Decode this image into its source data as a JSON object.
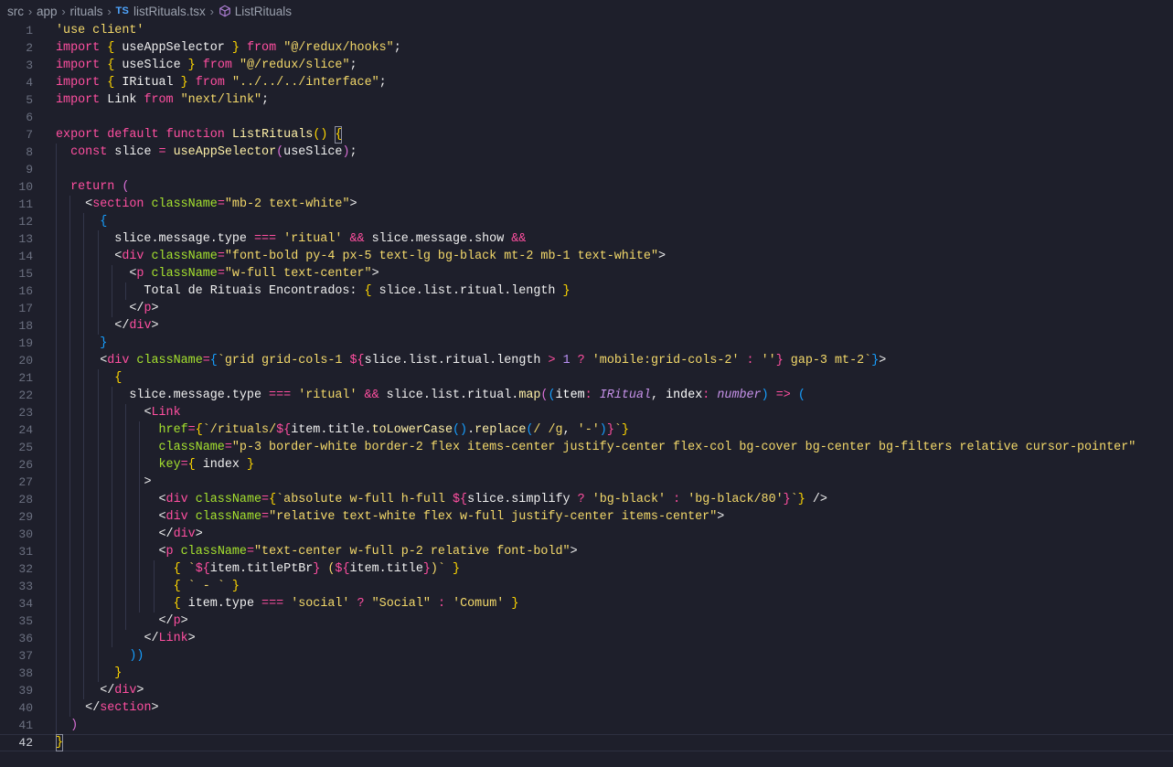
{
  "breadcrumb": {
    "items": [
      "src",
      "app",
      "rituals",
      "listRituals.tsx",
      "ListRituals"
    ],
    "file_badge": "TS"
  },
  "editor": {
    "current_line": 42,
    "lines": [
      [
        [
          "str",
          "'use client'"
        ]
      ],
      [
        [
          "kw",
          "import"
        ],
        [
          "t",
          " "
        ],
        [
          "br1",
          "{"
        ],
        [
          "t",
          " useAppSelector "
        ],
        [
          "br1",
          "}"
        ],
        [
          "t",
          " "
        ],
        [
          "kw",
          "from"
        ],
        [
          "t",
          " "
        ],
        [
          "str",
          "\"@/redux/hooks\""
        ],
        [
          "t",
          ";"
        ]
      ],
      [
        [
          "kw",
          "import"
        ],
        [
          "t",
          " "
        ],
        [
          "br1",
          "{"
        ],
        [
          "t",
          " useSlice "
        ],
        [
          "br1",
          "}"
        ],
        [
          "t",
          " "
        ],
        [
          "kw",
          "from"
        ],
        [
          "t",
          " "
        ],
        [
          "str",
          "\"@/redux/slice\""
        ],
        [
          "t",
          ";"
        ]
      ],
      [
        [
          "kw",
          "import"
        ],
        [
          "t",
          " "
        ],
        [
          "br1",
          "{"
        ],
        [
          "t",
          " IRitual "
        ],
        [
          "br1",
          "}"
        ],
        [
          "t",
          " "
        ],
        [
          "kw",
          "from"
        ],
        [
          "t",
          " "
        ],
        [
          "str",
          "\"../../../interface\""
        ],
        [
          "t",
          ";"
        ]
      ],
      [
        [
          "kw",
          "import"
        ],
        [
          "t",
          " Link "
        ],
        [
          "kw",
          "from"
        ],
        [
          "t",
          " "
        ],
        [
          "str",
          "\"next/link\""
        ],
        [
          "t",
          ";"
        ]
      ],
      [],
      [
        [
          "kw",
          "export"
        ],
        [
          "t",
          " "
        ],
        [
          "kw",
          "default"
        ],
        [
          "t",
          " "
        ],
        [
          "kw",
          "function"
        ],
        [
          "t",
          " "
        ],
        [
          "fn",
          "ListRituals"
        ],
        [
          "br1",
          "()"
        ],
        [
          "t",
          " "
        ],
        [
          "br1",
          "{"
        ]
      ],
      [
        [
          "t",
          "  "
        ],
        [
          "kw",
          "const"
        ],
        [
          "t",
          " slice "
        ],
        [
          "op",
          "="
        ],
        [
          "t",
          " "
        ],
        [
          "fn",
          "useAppSelector"
        ],
        [
          "br2",
          "("
        ],
        [
          "t",
          "useSlice"
        ],
        [
          "br2",
          ")"
        ],
        [
          "t",
          ";"
        ]
      ],
      [],
      [
        [
          "t",
          "  "
        ],
        [
          "kw",
          "return"
        ],
        [
          "t",
          " "
        ],
        [
          "br2",
          "("
        ]
      ],
      [
        [
          "t",
          "    "
        ],
        [
          "pun",
          "<"
        ],
        [
          "tag",
          "section"
        ],
        [
          "t",
          " "
        ],
        [
          "attr",
          "className"
        ],
        [
          "op",
          "="
        ],
        [
          "str",
          "\"mb-2 text-white\""
        ],
        [
          "pun",
          ">"
        ]
      ],
      [
        [
          "t",
          "      "
        ],
        [
          "br3",
          "{"
        ]
      ],
      [
        [
          "t",
          "        slice.message.type "
        ],
        [
          "op",
          "==="
        ],
        [
          "t",
          " "
        ],
        [
          "str",
          "'ritual'"
        ],
        [
          "t",
          " "
        ],
        [
          "op",
          "&&"
        ],
        [
          "t",
          " slice.message.show "
        ],
        [
          "op",
          "&&"
        ]
      ],
      [
        [
          "t",
          "        "
        ],
        [
          "pun",
          "<"
        ],
        [
          "tag",
          "div"
        ],
        [
          "t",
          " "
        ],
        [
          "attr",
          "className"
        ],
        [
          "op",
          "="
        ],
        [
          "str",
          "\"font-bold py-4 px-5 text-lg bg-black mt-2 mb-1 text-white\""
        ],
        [
          "pun",
          ">"
        ]
      ],
      [
        [
          "t",
          "          "
        ],
        [
          "pun",
          "<"
        ],
        [
          "tag",
          "p"
        ],
        [
          "t",
          " "
        ],
        [
          "attr",
          "className"
        ],
        [
          "op",
          "="
        ],
        [
          "str",
          "\"w-full text-center\""
        ],
        [
          "pun",
          ">"
        ]
      ],
      [
        [
          "t",
          "            Total de Rituais Encontrados: "
        ],
        [
          "br1",
          "{"
        ],
        [
          "t",
          " slice.list.ritual.length "
        ],
        [
          "br1",
          "}"
        ]
      ],
      [
        [
          "t",
          "          "
        ],
        [
          "pun",
          "</"
        ],
        [
          "tag",
          "p"
        ],
        [
          "pun",
          ">"
        ]
      ],
      [
        [
          "t",
          "        "
        ],
        [
          "pun",
          "</"
        ],
        [
          "tag",
          "div"
        ],
        [
          "pun",
          ">"
        ]
      ],
      [
        [
          "t",
          "      "
        ],
        [
          "br3",
          "}"
        ]
      ],
      [
        [
          "t",
          "      "
        ],
        [
          "pun",
          "<"
        ],
        [
          "tag",
          "div"
        ],
        [
          "t",
          " "
        ],
        [
          "attr",
          "className"
        ],
        [
          "op",
          "="
        ],
        [
          "br3",
          "{"
        ],
        [
          "tpl",
          "`grid grid-cols-1 "
        ],
        [
          "kw",
          "${"
        ],
        [
          "t",
          "slice.list.ritual.length "
        ],
        [
          "op",
          ">"
        ],
        [
          "t",
          " "
        ],
        [
          "num",
          "1"
        ],
        [
          "t",
          " "
        ],
        [
          "op",
          "?"
        ],
        [
          "t",
          " "
        ],
        [
          "str",
          "'mobile:grid-cols-2'"
        ],
        [
          "t",
          " "
        ],
        [
          "op",
          ":"
        ],
        [
          "t",
          " "
        ],
        [
          "str",
          "''"
        ],
        [
          "kw",
          "}"
        ],
        [
          "tpl",
          " gap-3 mt-2`"
        ],
        [
          "br3",
          "}"
        ],
        [
          "pun",
          ">"
        ]
      ],
      [
        [
          "t",
          "        "
        ],
        [
          "br1",
          "{"
        ]
      ],
      [
        [
          "t",
          "          slice.message.type "
        ],
        [
          "op",
          "==="
        ],
        [
          "t",
          " "
        ],
        [
          "str",
          "'ritual'"
        ],
        [
          "t",
          " "
        ],
        [
          "op",
          "&&"
        ],
        [
          "t",
          " slice.list.ritual."
        ],
        [
          "fn",
          "map"
        ],
        [
          "br2",
          "("
        ],
        [
          "br3",
          "("
        ],
        [
          "param",
          "item"
        ],
        [
          "op",
          ":"
        ],
        [
          "t",
          " "
        ],
        [
          "type",
          "IRitual"
        ],
        [
          "t",
          ", "
        ],
        [
          "param",
          "index"
        ],
        [
          "op",
          ":"
        ],
        [
          "t",
          " "
        ],
        [
          "type",
          "number"
        ],
        [
          "br3",
          ")"
        ],
        [
          "t",
          " "
        ],
        [
          "op",
          "=>"
        ],
        [
          "t",
          " "
        ],
        [
          "br3",
          "("
        ]
      ],
      [
        [
          "t",
          "            "
        ],
        [
          "pun",
          "<"
        ],
        [
          "tag",
          "Link"
        ]
      ],
      [
        [
          "t",
          "              "
        ],
        [
          "attr",
          "href"
        ],
        [
          "op",
          "="
        ],
        [
          "br1",
          "{"
        ],
        [
          "tpl",
          "`/rituals/"
        ],
        [
          "kw",
          "${"
        ],
        [
          "t",
          "item.title."
        ],
        [
          "fn",
          "toLowerCase"
        ],
        [
          "br3",
          "()"
        ],
        [
          "t",
          "."
        ],
        [
          "fn",
          "replace"
        ],
        [
          "br3",
          "("
        ],
        [
          "str",
          "/ /g"
        ],
        [
          "t",
          ", "
        ],
        [
          "str",
          "'-'"
        ],
        [
          "br3",
          ")"
        ],
        [
          "kw",
          "}"
        ],
        [
          "tpl",
          "`"
        ],
        [
          "br1",
          "}"
        ]
      ],
      [
        [
          "t",
          "              "
        ],
        [
          "attr",
          "className"
        ],
        [
          "op",
          "="
        ],
        [
          "str",
          "\"p-3 border-white border-2 flex items-center justify-center flex-col bg-cover bg-center bg-filters relative cursor-pointer\""
        ]
      ],
      [
        [
          "t",
          "              "
        ],
        [
          "attr",
          "key"
        ],
        [
          "op",
          "="
        ],
        [
          "br1",
          "{"
        ],
        [
          "t",
          " index "
        ],
        [
          "br1",
          "}"
        ]
      ],
      [
        [
          "t",
          "            "
        ],
        [
          "pun",
          ">"
        ]
      ],
      [
        [
          "t",
          "              "
        ],
        [
          "pun",
          "<"
        ],
        [
          "tag",
          "div"
        ],
        [
          "t",
          " "
        ],
        [
          "attr",
          "className"
        ],
        [
          "op",
          "="
        ],
        [
          "br1",
          "{"
        ],
        [
          "tpl",
          "`absolute w-full h-full "
        ],
        [
          "kw",
          "${"
        ],
        [
          "t",
          "slice.simplify "
        ],
        [
          "op",
          "?"
        ],
        [
          "t",
          " "
        ],
        [
          "str",
          "'bg-black'"
        ],
        [
          "t",
          " "
        ],
        [
          "op",
          ":"
        ],
        [
          "t",
          " "
        ],
        [
          "str",
          "'bg-black/80'"
        ],
        [
          "kw",
          "}"
        ],
        [
          "tpl",
          "`"
        ],
        [
          "br1",
          "}"
        ],
        [
          "t",
          " "
        ],
        [
          "pun",
          "/>"
        ]
      ],
      [
        [
          "t",
          "              "
        ],
        [
          "pun",
          "<"
        ],
        [
          "tag",
          "div"
        ],
        [
          "t",
          " "
        ],
        [
          "attr",
          "className"
        ],
        [
          "op",
          "="
        ],
        [
          "str",
          "\"relative text-white flex w-full justify-center items-center\""
        ],
        [
          "pun",
          ">"
        ]
      ],
      [
        [
          "t",
          "              "
        ],
        [
          "pun",
          "</"
        ],
        [
          "tag",
          "div"
        ],
        [
          "pun",
          ">"
        ]
      ],
      [
        [
          "t",
          "              "
        ],
        [
          "pun",
          "<"
        ],
        [
          "tag",
          "p"
        ],
        [
          "t",
          " "
        ],
        [
          "attr",
          "className"
        ],
        [
          "op",
          "="
        ],
        [
          "str",
          "\"text-center w-full p-2 relative font-bold\""
        ],
        [
          "pun",
          ">"
        ]
      ],
      [
        [
          "t",
          "                "
        ],
        [
          "br1",
          "{"
        ],
        [
          "t",
          " "
        ],
        [
          "tpl",
          "`"
        ],
        [
          "kw",
          "${"
        ],
        [
          "t",
          "item.titlePtBr"
        ],
        [
          "kw",
          "}"
        ],
        [
          "tpl",
          " ("
        ],
        [
          "kw",
          "${"
        ],
        [
          "t",
          "item.title"
        ],
        [
          "kw",
          "}"
        ],
        [
          "tpl",
          ")`"
        ],
        [
          "t",
          " "
        ],
        [
          "br1",
          "}"
        ]
      ],
      [
        [
          "t",
          "                "
        ],
        [
          "br1",
          "{"
        ],
        [
          "t",
          " "
        ],
        [
          "tpl",
          "` - `"
        ],
        [
          "t",
          " "
        ],
        [
          "br1",
          "}"
        ]
      ],
      [
        [
          "t",
          "                "
        ],
        [
          "br1",
          "{"
        ],
        [
          "t",
          " item.type "
        ],
        [
          "op",
          "==="
        ],
        [
          "t",
          " "
        ],
        [
          "str",
          "'social'"
        ],
        [
          "t",
          " "
        ],
        [
          "op",
          "?"
        ],
        [
          "t",
          " "
        ],
        [
          "str",
          "\"Social\""
        ],
        [
          "t",
          " "
        ],
        [
          "op",
          ":"
        ],
        [
          "t",
          " "
        ],
        [
          "str",
          "'Comum'"
        ],
        [
          "t",
          " "
        ],
        [
          "br1",
          "}"
        ]
      ],
      [
        [
          "t",
          "              "
        ],
        [
          "pun",
          "</"
        ],
        [
          "tag",
          "p"
        ],
        [
          "pun",
          ">"
        ]
      ],
      [
        [
          "t",
          "            "
        ],
        [
          "pun",
          "</"
        ],
        [
          "tag",
          "Link"
        ],
        [
          "pun",
          ">"
        ]
      ],
      [
        [
          "t",
          "          "
        ],
        [
          "br3",
          "))"
        ]
      ],
      [
        [
          "t",
          "        "
        ],
        [
          "br1",
          "}"
        ]
      ],
      [
        [
          "t",
          "      "
        ],
        [
          "pun",
          "</"
        ],
        [
          "tag",
          "div"
        ],
        [
          "pun",
          ">"
        ]
      ],
      [
        [
          "t",
          "    "
        ],
        [
          "pun",
          "</"
        ],
        [
          "tag",
          "section"
        ],
        [
          "pun",
          ">"
        ]
      ],
      [
        [
          "t",
          "  "
        ],
        [
          "br2",
          ")"
        ]
      ],
      [
        [
          "br1",
          "}"
        ]
      ]
    ]
  }
}
